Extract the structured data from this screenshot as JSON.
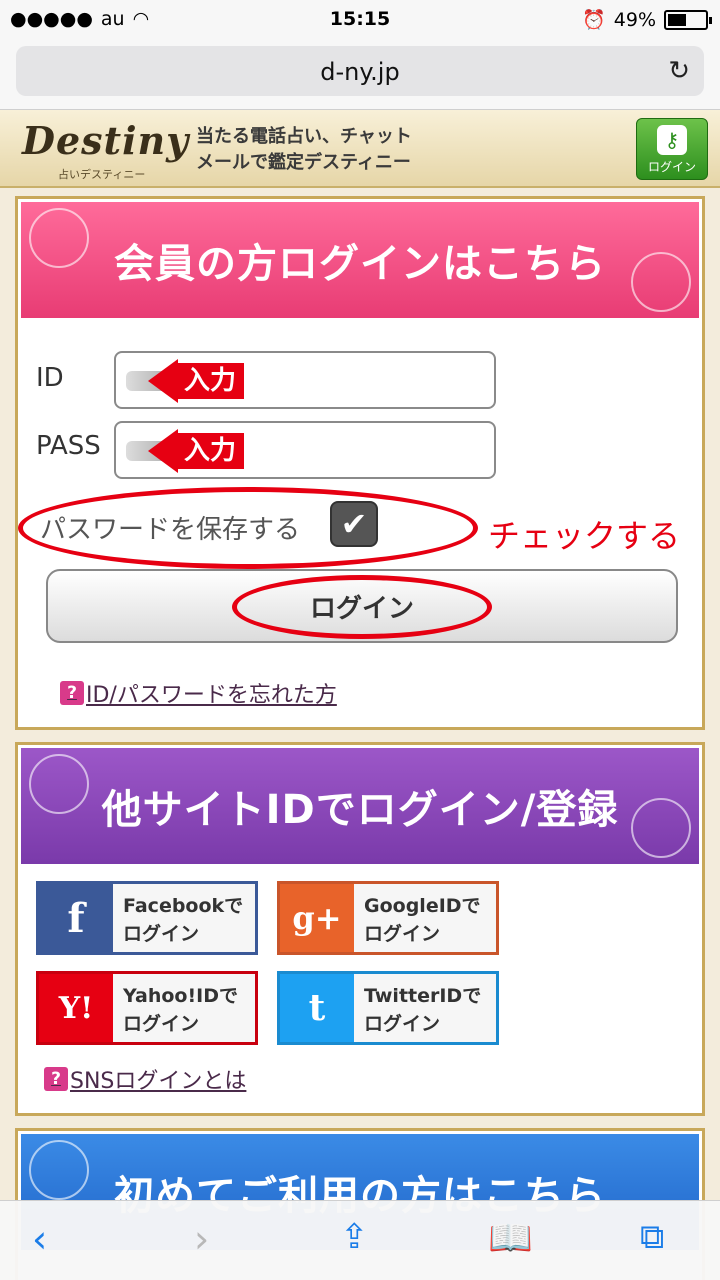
{
  "status": {
    "carrier": "au",
    "time": "15:15",
    "battery": "49%",
    "battery_level": 0.49
  },
  "browser": {
    "url": "d-ny.jp"
  },
  "header": {
    "logo": "Destiny",
    "logo_sub": "占いデスティニー",
    "tagline_line1": "当たる電話占い、チャット",
    "tagline_line2": "メールで鑑定デスティニー",
    "login_label": "ログイン"
  },
  "login_panel": {
    "title": "会員の方ログインはこちら",
    "id_label": "ID",
    "pass_label": "PASS",
    "arrow_text": "入力",
    "save_password_label": "パスワードを保存する",
    "check_annotation": "チェックする",
    "login_button": "ログイン",
    "forgot_link": "ID/パスワードを忘れた方"
  },
  "sns_panel": {
    "title": "他サイトIDでログイン/登録",
    "buttons": [
      {
        "line1": "Facebookで",
        "line2": "ログイン",
        "icon": "f",
        "color": "#3b5998"
      },
      {
        "line1": "GoogleIDで",
        "line2": "ログイン",
        "icon": "g+",
        "color": "#e8632a"
      },
      {
        "line1": "Yahoo!IDで",
        "line2": "ログイン",
        "icon": "Y!",
        "color": "#e60012"
      },
      {
        "line1": "TwitterIDで",
        "line2": "ログイン",
        "icon": "t",
        "color": "#1da1f2"
      }
    ],
    "sns_link": "SNSログインとは"
  },
  "first_panel": {
    "title": "初めてご利用の方はこちら"
  }
}
